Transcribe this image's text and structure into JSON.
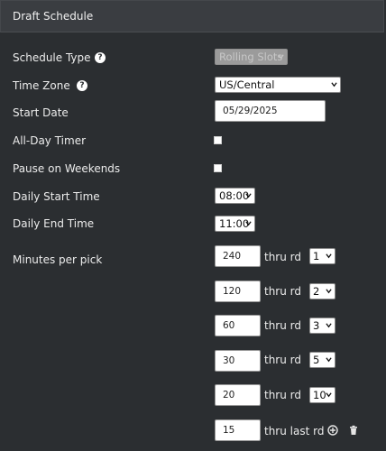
{
  "panel": {
    "title": "Draft Schedule"
  },
  "labels": {
    "schedule_type": "Schedule Type",
    "time_zone": "Time Zone",
    "start_date": "Start Date",
    "all_day_timer": "All-Day Timer",
    "pause_weekends": "Pause on Weekends",
    "daily_start": "Daily Start Time",
    "daily_end": "Daily End Time",
    "minutes_per_pick": "Minutes per pick"
  },
  "help": "?",
  "fields": {
    "schedule_type": "Rolling Slots",
    "time_zone": "US/Central",
    "start_date": "05/29/2025",
    "daily_start": "08:00",
    "daily_end": "11:00"
  },
  "checkboxes": {
    "all_day_timer": false,
    "pause_weekends": false
  },
  "minutes_rows": [
    {
      "minutes": "240",
      "thru_label": "thru rd",
      "round": "1"
    },
    {
      "minutes": "120",
      "thru_label": "thru rd",
      "round": "2"
    },
    {
      "minutes": "60",
      "thru_label": "thru rd",
      "round": "3"
    },
    {
      "minutes": "30",
      "thru_label": "thru rd",
      "round": "5"
    },
    {
      "minutes": "20",
      "thru_label": "thru rd",
      "round": "10"
    },
    {
      "minutes": "15",
      "thru_label": "thru last rd"
    }
  ],
  "icons": {
    "add": "plus-circle-icon",
    "delete": "trash-icon",
    "help": "question-circle-icon",
    "chevron": "chevron-down-icon"
  }
}
